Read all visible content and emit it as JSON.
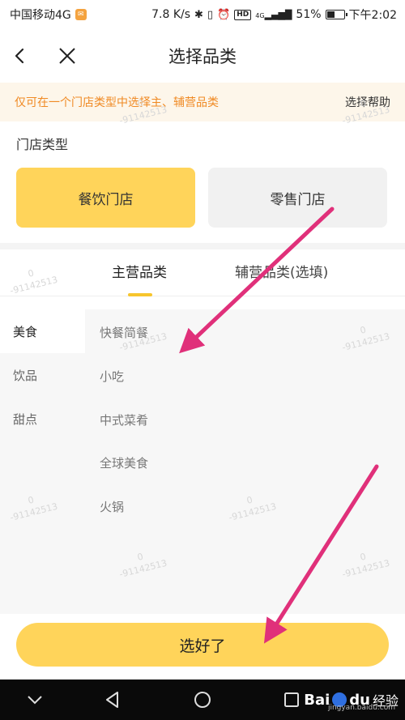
{
  "status_bar": {
    "carrier": "中国移动4G",
    "speed": "7.8 K/s",
    "battery_percent": "51%",
    "battery_level": 0.51,
    "time": "下午2:02",
    "hd": "HD",
    "network": "4G"
  },
  "nav": {
    "title": "选择品类"
  },
  "notice": {
    "text": "仅可在一个门店类型中选择主、辅营品类",
    "help": "选择帮助"
  },
  "store_type": {
    "label": "门店类型",
    "options": [
      "餐饮门店",
      "零售门店"
    ],
    "selected": "餐饮门店"
  },
  "tabs": {
    "main": "主营品类",
    "sub": "辅营品类(选填)",
    "active": "主营品类"
  },
  "categories": {
    "left": [
      "美食",
      "饮品",
      "甜点"
    ],
    "selected": "美食",
    "right": [
      "快餐简餐",
      "小吃",
      "中式菜肴",
      "全球美食",
      "火锅"
    ]
  },
  "watermark": {
    "line1": "0",
    "line2": "-91142513"
  },
  "confirm_button": "选好了",
  "baidu": {
    "logo": "Bai",
    "logo_suffix": "du",
    "jingyan": "经验",
    "url": "jingyan.baidu.com"
  },
  "colors": {
    "accent": "#ffd45a",
    "notice_text": "#f08a24",
    "notice_bg": "#fdf6ea",
    "arrow": "#e0307a"
  }
}
